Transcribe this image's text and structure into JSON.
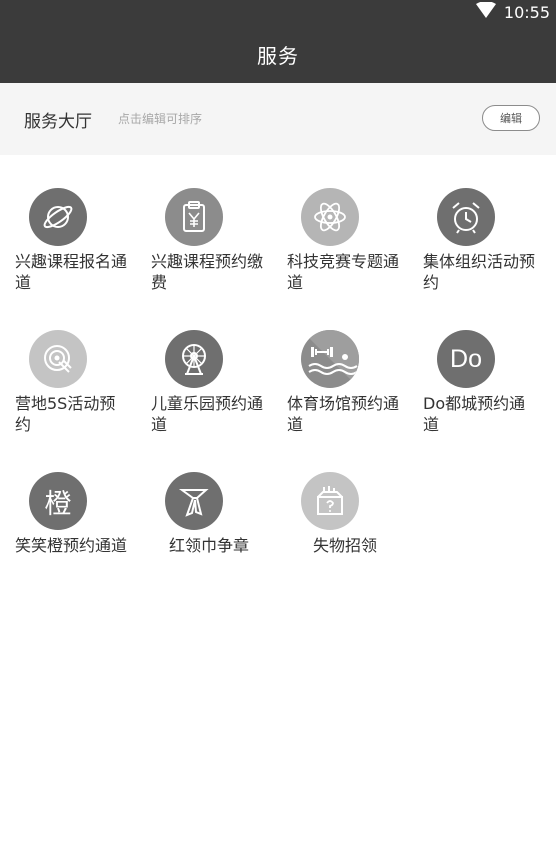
{
  "status_bar": {
    "time": "10:55",
    "wifi_icon": "wifi-icon"
  },
  "header": {
    "title": "服务"
  },
  "hall": {
    "title": "服务大厅",
    "hint": "点击编辑可排序",
    "edit_label": "编辑"
  },
  "services": [
    {
      "label": "兴趣课程报名通道",
      "icon": "planet-icon",
      "shade": "#6f6f6f"
    },
    {
      "label": "兴趣课程预约缴费",
      "icon": "clipboard-yen-icon",
      "shade": "#8c8c8c"
    },
    {
      "label": "科技竞赛专题通道",
      "icon": "atom-icon",
      "shade": "#b5b5b5"
    },
    {
      "label": "集体组织活动预约",
      "icon": "alarm-clock-icon",
      "shade": "#6f6f6f"
    },
    {
      "label": "营地5S活动预约",
      "icon": "target-hand-icon",
      "shade": "#c4c4c4"
    },
    {
      "label": "儿童乐园预约通道",
      "icon": "ferris-wheel-icon",
      "shade": "#6f6f6f"
    },
    {
      "label": "体育场馆预约通道",
      "icon": "swimming-dumbbell-icon",
      "shade": "#8c8c8c"
    },
    {
      "label": "Do都城预约通道",
      "icon": "do-text-icon",
      "icon_text": "Do",
      "shade": "#6f6f6f"
    },
    {
      "label": "笑笑橙预约通道",
      "icon": "orange-char-icon",
      "icon_text": "橙",
      "shade": "#6f6f6f"
    },
    {
      "label": "红领巾争章",
      "icon": "red-scarf-icon",
      "shade": "#6f6f6f"
    },
    {
      "label": "失物招领",
      "icon": "lost-found-box-icon",
      "shade": "#c4c4c4"
    }
  ]
}
